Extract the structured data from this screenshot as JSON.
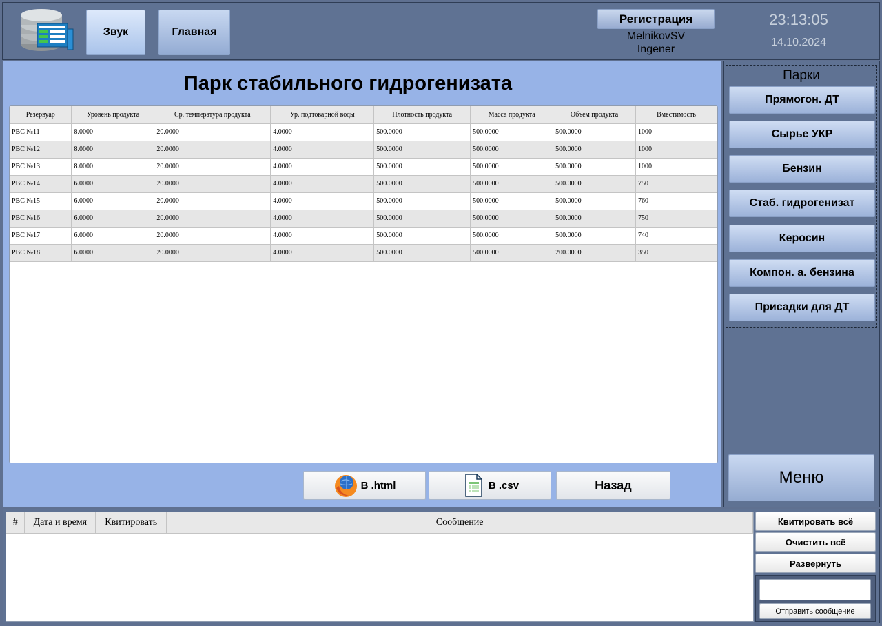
{
  "header": {
    "sound_label": "Звук",
    "main_label": "Главная",
    "register_label": "Регистрация",
    "user_name": "MelnikovSV",
    "user_role": "Ingener",
    "time": "23:13:05",
    "date": "14.10.2024"
  },
  "page": {
    "title": "Парк стабильного гидрогенизата"
  },
  "table": {
    "columns": [
      "Резервуар",
      "Уровень продукта",
      "Ср. температура продукта",
      "Ур. подтоварной воды",
      "Плотность продукта",
      "Масса продукта",
      "Объем продукта",
      "Вместимость"
    ],
    "rows": [
      [
        "РВС №11",
        "8.0000",
        "20.0000",
        "4.0000",
        "500.0000",
        "500.0000",
        "500.0000",
        "1000"
      ],
      [
        "РВС №12",
        "8.0000",
        "20.0000",
        "4.0000",
        "500.0000",
        "500.0000",
        "500.0000",
        "1000"
      ],
      [
        "РВС №13",
        "8.0000",
        "20.0000",
        "4.0000",
        "500.0000",
        "500.0000",
        "500.0000",
        "1000"
      ],
      [
        "РВС №14",
        "6.0000",
        "20.0000",
        "4.0000",
        "500.0000",
        "500.0000",
        "500.0000",
        "750"
      ],
      [
        "РВС №15",
        "6.0000",
        "20.0000",
        "4.0000",
        "500.0000",
        "500.0000",
        "500.0000",
        "760"
      ],
      [
        "РВС №16",
        "6.0000",
        "20.0000",
        "4.0000",
        "500.0000",
        "500.0000",
        "500.0000",
        "750"
      ],
      [
        "РВС №17",
        "6.0000",
        "20.0000",
        "4.0000",
        "500.0000",
        "500.0000",
        "500.0000",
        "740"
      ],
      [
        "РВС №18",
        "6.0000",
        "20.0000",
        "4.0000",
        "500.0000",
        "500.0000",
        "200.0000",
        "350"
      ]
    ]
  },
  "export": {
    "html_label": "В .html",
    "csv_label": "В .csv",
    "back_label": "Назад"
  },
  "parks": {
    "title": "Парки",
    "items": [
      "Прямогон. ДТ",
      "Сырье УКР",
      "Бензин",
      "Стаб. гидрогенизат",
      "Керосин",
      "Компон. а. бензина",
      "Присадки для ДТ"
    ],
    "menu_label": "Меню"
  },
  "messages": {
    "columns": [
      "#",
      "Дата и время",
      "Квитировать",
      "Сообщение"
    ],
    "ack_all_label": "Квитировать всё",
    "clear_all_label": "Очистить всё",
    "expand_label": "Развернуть",
    "input_value": "",
    "send_label": "Отправить сообщение"
  },
  "icons": {
    "logo": "database-documents-icon",
    "html": "browser-globe-icon",
    "csv": "spreadsheet-file-icon"
  },
  "colors": {
    "main_bg": "#97b3e7",
    "frame_bg": "#5f7293",
    "button_gradient_top": "#cfddf3",
    "button_gradient_bottom": "#9cb2d9",
    "row_alt": "#e6e6e6"
  }
}
